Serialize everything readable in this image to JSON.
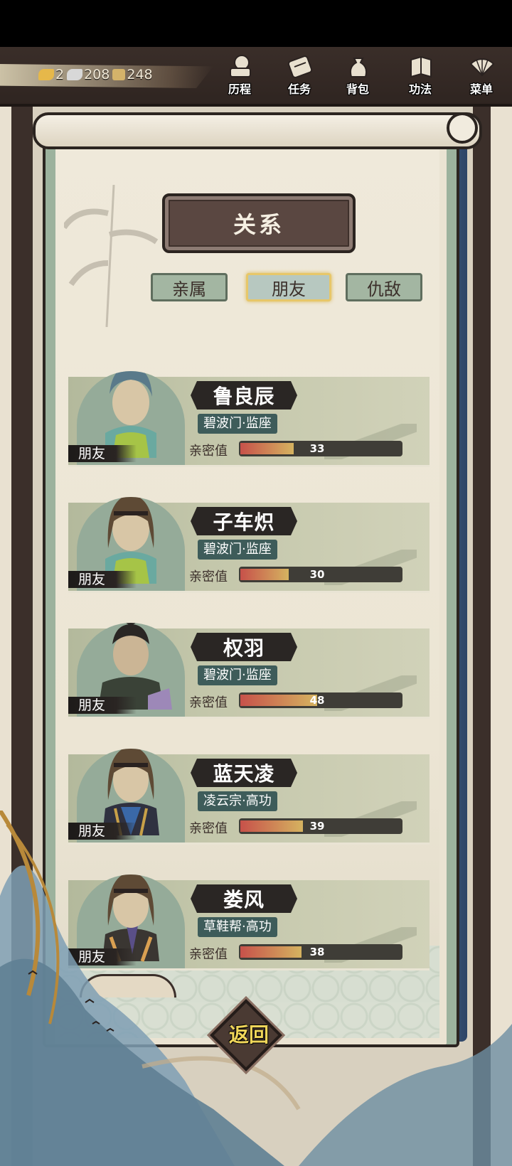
{
  "currency": [
    {
      "icon": "gold-ingot-icon",
      "value": "2",
      "color": "#e6b84a"
    },
    {
      "icon": "silver-ingot-icon",
      "value": "208",
      "color": "#d8d8d8"
    },
    {
      "icon": "copper-coin-icon",
      "value": "248",
      "color": "#d4b36a"
    }
  ],
  "menu": [
    {
      "id": "journey",
      "label": "历程",
      "icon": "scroll-icon"
    },
    {
      "id": "tasks",
      "label": "任务",
      "icon": "quest-scroll-icon"
    },
    {
      "id": "bag",
      "label": "背包",
      "icon": "pouch-icon"
    },
    {
      "id": "skills",
      "label": "功法",
      "icon": "book-icon"
    },
    {
      "id": "menu",
      "label": "菜单",
      "icon": "fan-icon"
    }
  ],
  "title": "关系",
  "tabs": [
    {
      "label": "亲属",
      "active": false
    },
    {
      "label": "朋友",
      "active": true
    },
    {
      "label": "仇敌",
      "active": false
    }
  ],
  "affinity_label": "亲密值",
  "people": [
    {
      "name": "鲁良辰",
      "sect": "碧波门·监座",
      "relation": "朋友",
      "affinity": 33,
      "fill_pct": 0.33
    },
    {
      "name": "子车炽",
      "sect": "碧波门·监座",
      "relation": "朋友",
      "affinity": 30,
      "fill_pct": 0.3
    },
    {
      "name": "权羽",
      "sect": "碧波门·监座",
      "relation": "朋友",
      "affinity": 48,
      "fill_pct": 0.48
    },
    {
      "name": "蓝天凌",
      "sect": "凌云宗·高功",
      "relation": "朋友",
      "affinity": 39,
      "fill_pct": 0.39
    },
    {
      "name": "娄风",
      "sect": "草鞋帮·高功",
      "relation": "朋友",
      "affinity": 38,
      "fill_pct": 0.38
    }
  ],
  "back_label": "返回"
}
